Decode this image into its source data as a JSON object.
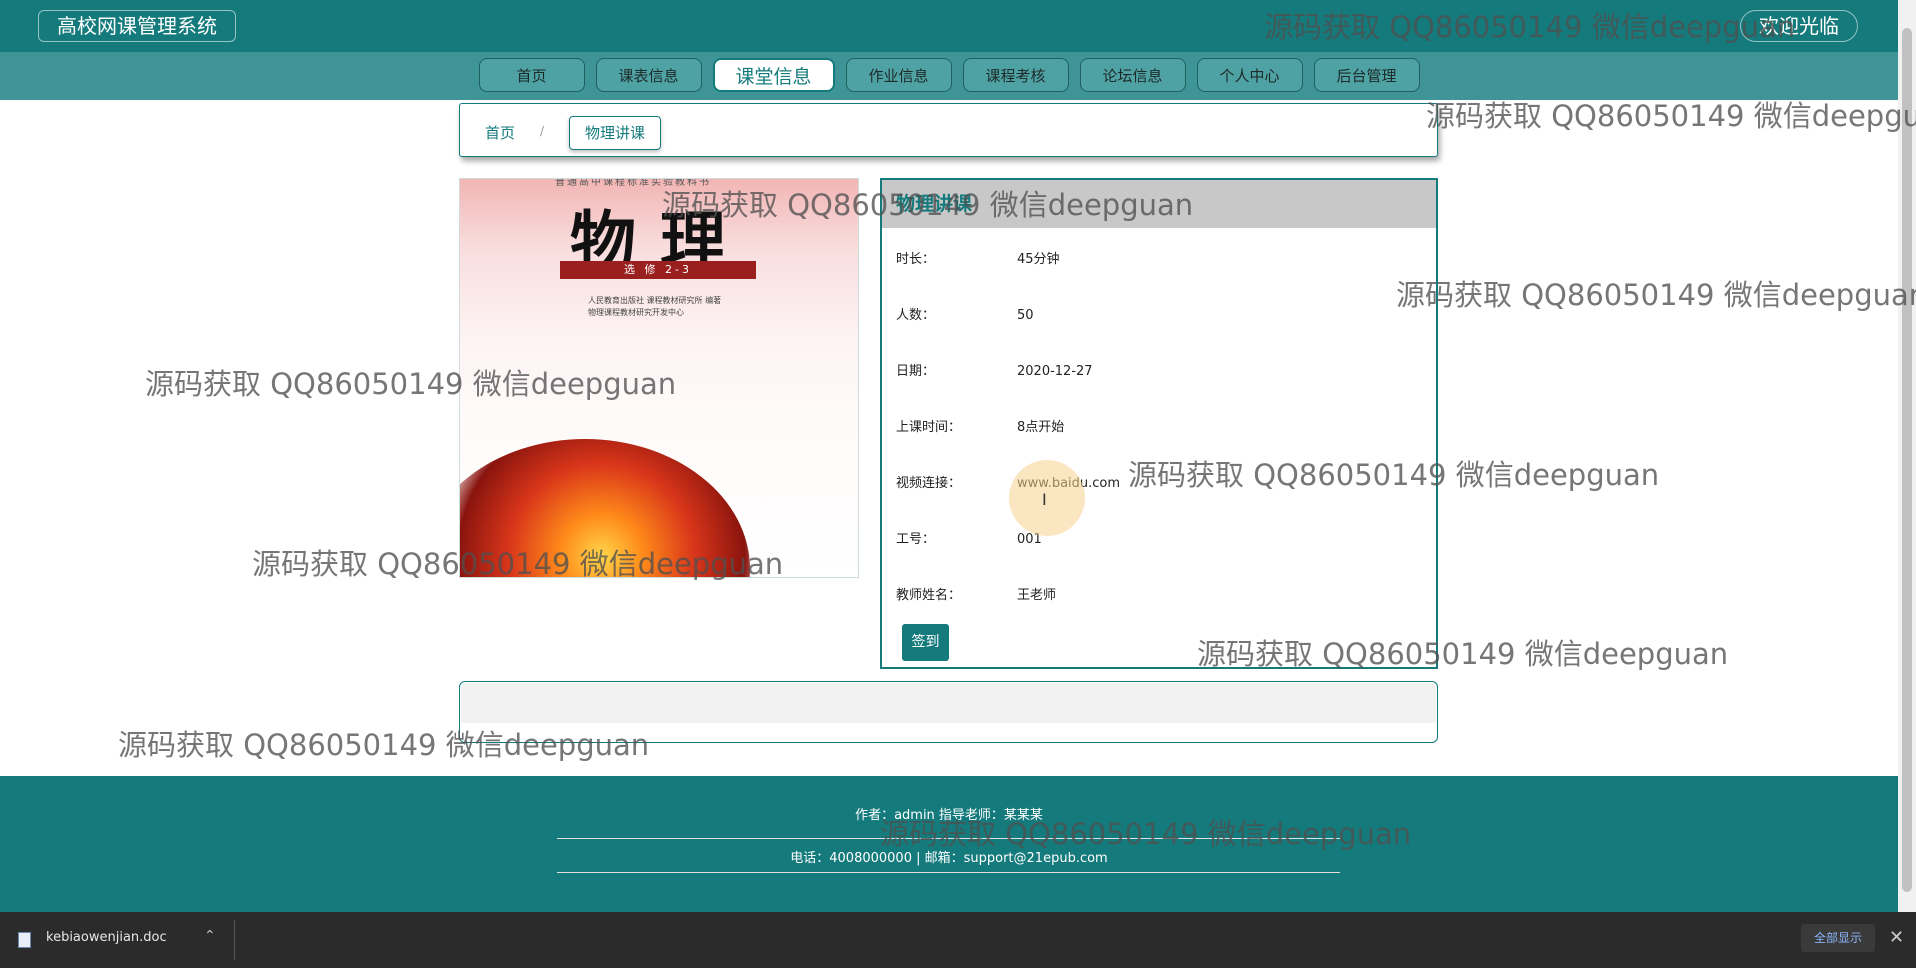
{
  "header": {
    "brand": "高校网课管理系统",
    "welcome": "欢迎光临"
  },
  "nav": {
    "items": [
      {
        "label": "首页"
      },
      {
        "label": "课表信息"
      },
      {
        "label": "课堂信息"
      },
      {
        "label": "作业信息"
      },
      {
        "label": "课程考核"
      },
      {
        "label": "论坛信息"
      },
      {
        "label": "个人中心"
      },
      {
        "label": "后台管理"
      }
    ],
    "active_index": 2
  },
  "breadcrumb": {
    "home": "首页",
    "separator": "/",
    "current": "物理讲课"
  },
  "cover": {
    "top_text": "普通高中课程标准实验教科书",
    "title": "物理",
    "band": "选 修 2-3",
    "publisher_line1": "人民教育出版社  课程教材研究所  编著",
    "publisher_line2": "物理课程教材研究开发中心"
  },
  "detail": {
    "title": "物理讲课",
    "fields": [
      {
        "label": "时长：",
        "value": "45分钟"
      },
      {
        "label": "人数：",
        "value": "50"
      },
      {
        "label": "日期：",
        "value": "2020-12-27"
      },
      {
        "label": "上课时间：",
        "value": "8点开始"
      },
      {
        "label": "视频连接：",
        "value": "www.baidu.com"
      },
      {
        "label": "工号：",
        "value": "001"
      },
      {
        "label": "教师姓名：",
        "value": "王老师"
      }
    ],
    "signin_label": "签到"
  },
  "footer": {
    "line1": "作者：admin 指导老师：某某某",
    "line2": "电话：4008000000 | 邮箱：support@21epub.com"
  },
  "download_bar": {
    "filename": "kebiaowenjian.doc",
    "show_all": "全部显示",
    "close": "✕",
    "chevron": "⌃"
  },
  "watermark": {
    "text": "源码获取 QQ86050149 微信deepguan"
  },
  "colors": {
    "primary": "#147a7c",
    "nav_bg": "#3e9496",
    "panel_head": "#c8c8c8"
  }
}
